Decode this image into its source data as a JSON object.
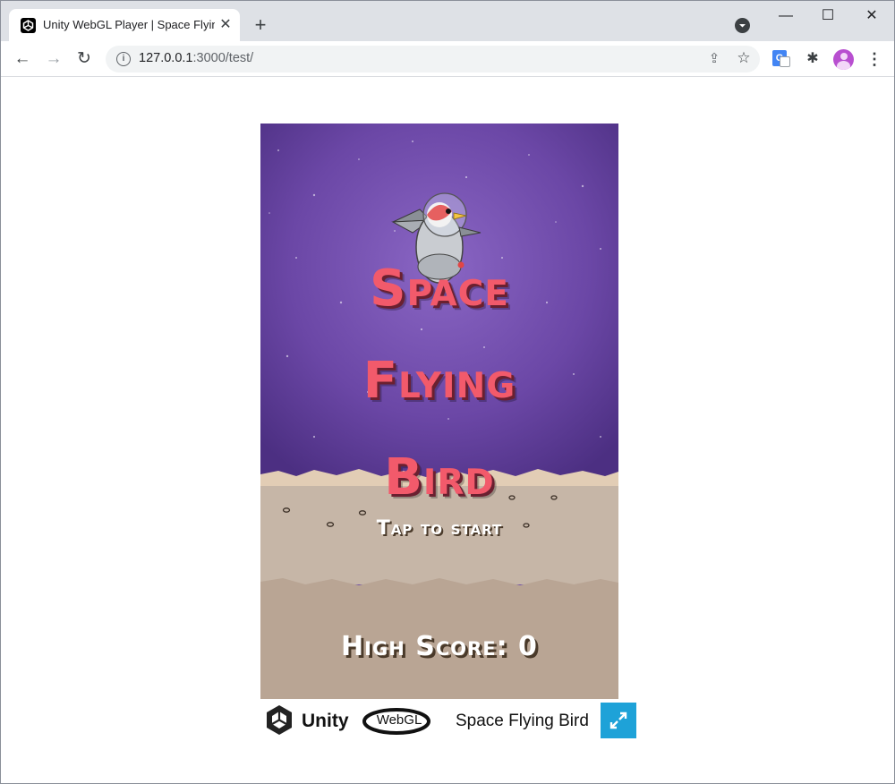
{
  "browser": {
    "tab_title": "Unity WebGL Player | Space Flying Bird",
    "tab_close": "✕",
    "new_tab": "+",
    "url_host": "127.0.0.1",
    "url_rest": ":3000/test/",
    "window_minimize": "—",
    "window_maximize": "☐",
    "window_close": "✕",
    "back": "←",
    "forward": "→",
    "reload": "↻",
    "info": "i",
    "share": "⇪",
    "star": "☆",
    "extensions": "✱",
    "menu": "⋮",
    "translate": "G"
  },
  "game": {
    "title_line1": "Space",
    "title_line2": "Flying",
    "title_line3": "Bird",
    "tap_to_start": "Tap to start",
    "high_score": "High Score: 0"
  },
  "footer": {
    "unity_word": "Unity",
    "webgl_word": "WebGL",
    "game_name": "Space Flying Bird"
  },
  "colors": {
    "sky": "#6a4aa8",
    "ground_top": "#c8b8a8",
    "ground_bottom": "#bba796",
    "title": "#f25a6b",
    "fullscreen_button": "#1ea2d8"
  }
}
